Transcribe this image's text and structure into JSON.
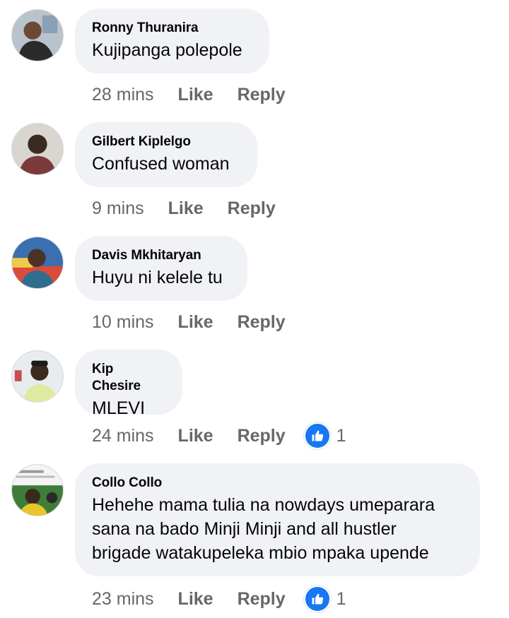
{
  "comments": [
    {
      "author": "Ronny Thuranira",
      "text": [
        "Kujipanga polepole"
      ],
      "time": "28 mins",
      "like": "Like",
      "reply": "Reply",
      "reactions": ""
    },
    {
      "author": "Gilbert Kiplelgo",
      "text": [
        "Confused woman"
      ],
      "time": "9 mins",
      "like": "Like",
      "reply": "Reply",
      "reactions": ""
    },
    {
      "author": "Davis Mkhitaryan",
      "text": [
        "Huyu ni kelele tu"
      ],
      "time": "10 mins",
      "like": "Like",
      "reply": "Reply",
      "reactions": ""
    },
    {
      "author": "Kip Chesire",
      "text": [
        "MLEVI"
      ],
      "time": "24 mins",
      "like": "Like",
      "reply": "Reply",
      "reactions": "1"
    },
    {
      "author": "Collo Collo",
      "text": [
        "Hehehe mama tulia na nowdays  umeparara",
        "sana na bado Minji Minji and all hustler",
        "brigade watakupeleka mbio mpaka upende"
      ],
      "time": "23 mins",
      "like": "Like",
      "reply": "Reply",
      "reactions": "1"
    }
  ],
  "icons": {
    "reaction": "thumbs-up-icon"
  },
  "colors": {
    "bubble": "#f0f2f5",
    "meta": "#65676b",
    "like_blue": "#1877f2"
  }
}
